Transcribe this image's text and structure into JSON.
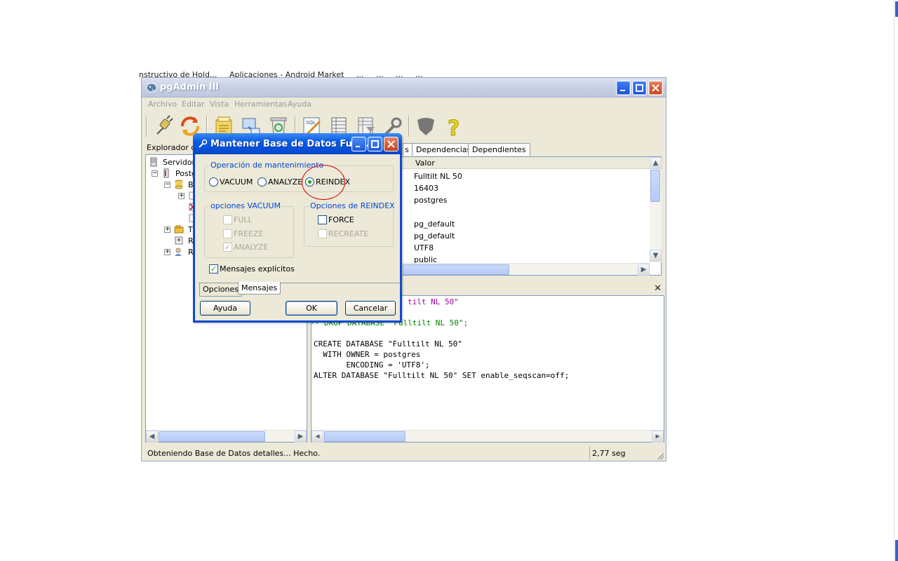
{
  "background": {
    "toolbar_fragments": [
      "nstructivo de Hold...",
      "Aplicaciones - Android Market",
      "...",
      "...",
      "...",
      "..."
    ],
    "accent": "#3a5fc9"
  },
  "main_window": {
    "title": "pgAdmin III",
    "menu": [
      "Archivo",
      "Editar",
      "Vista",
      "Herramientas",
      "Ayuda"
    ],
    "toolbar_icons": [
      "plug-icon",
      "refresh-icon",
      "properties-icon",
      "create-icon",
      "trash-icon",
      "sql-icon",
      "grid-icon",
      "filter-icon",
      "wrench-icon",
      "shield-icon",
      "help-icon"
    ],
    "explorer_header": "Explorador de",
    "tree": [
      {
        "label": "Servidore",
        "indent": 0,
        "icon": "server-group-icon",
        "expander": ""
      },
      {
        "label": "Postg",
        "indent": 1,
        "icon": "server-icon",
        "expander": "−"
      },
      {
        "label": "B",
        "indent": 2,
        "icon": "database-icon",
        "expander": "−"
      },
      {
        "label": "",
        "indent": 3,
        "icon": "db-item-icon",
        "expander": "+"
      },
      {
        "label": "",
        "indent": 3,
        "icon": "db-selected-icon",
        "expander": ""
      },
      {
        "label": "",
        "indent": 3,
        "icon": "db-item-icon",
        "expander": ""
      },
      {
        "label": "T",
        "indent": 2,
        "icon": "tablespace-icon",
        "expander": "+"
      },
      {
        "label": "R",
        "indent": 2,
        "icon": "role-group-icon",
        "expander": ""
      },
      {
        "label": "R",
        "indent": 2,
        "icon": "login-role-icon",
        "expander": "+"
      }
    ],
    "tabs": [
      "s",
      "Dependencias",
      "Dependientes"
    ],
    "props_header": {
      "valor": "Valor"
    },
    "props_values": [
      "Fulltilt NL 50",
      "16403",
      "postgres",
      "",
      "pg_default",
      "pg_default",
      "UTF8",
      "public"
    ],
    "sql_lines": [
      {
        "text": "tilt NL 50\"",
        "kind": "str"
      },
      {
        "text": "",
        "kind": "plain"
      },
      {
        "text": "-- DROP DATABASE \"Fulltilt NL 50\";",
        "kind": "cmt"
      },
      {
        "text": "",
        "kind": "plain"
      },
      {
        "text": "CREATE DATABASE \"Fulltilt NL 50\"",
        "kind": "plain"
      },
      {
        "text": "  WITH OWNER = postgres",
        "kind": "plain"
      },
      {
        "text": "       ENCODING = 'UTF8';",
        "kind": "plain"
      },
      {
        "text": "ALTER DATABASE \"Fulltilt NL 50\" SET enable_seqscan=off;",
        "kind": "plain"
      }
    ],
    "status_text": "Obteniendo Base de Datos detalles... Hecho.",
    "status_time": "2,77 seg"
  },
  "dialog": {
    "title": "Mantener Base de Datos Fullti...",
    "group_operation": "Operación de mantenimiento",
    "radio_vacuum": "VACUUM",
    "radio_analyze": "ANALYZE",
    "radio_reindex": "REINDEX",
    "selected_operation": "REINDEX",
    "group_vacuum": "opciones VACUUM",
    "vacuum_full": "FULL",
    "vacuum_freeze": "FREEZE",
    "vacuum_analyze": "ANALYZE",
    "group_reindex": "Opciones de REINDEX",
    "reindex_force": "FORCE",
    "reindex_recreate": "RECREATE",
    "verbose_label": "Mensajes explícitos",
    "tab_options": "Opciones",
    "tab_messages": "Mensajes",
    "btn_help": "Ayuda",
    "btn_ok": "OK",
    "btn_cancel": "Cancelar"
  }
}
